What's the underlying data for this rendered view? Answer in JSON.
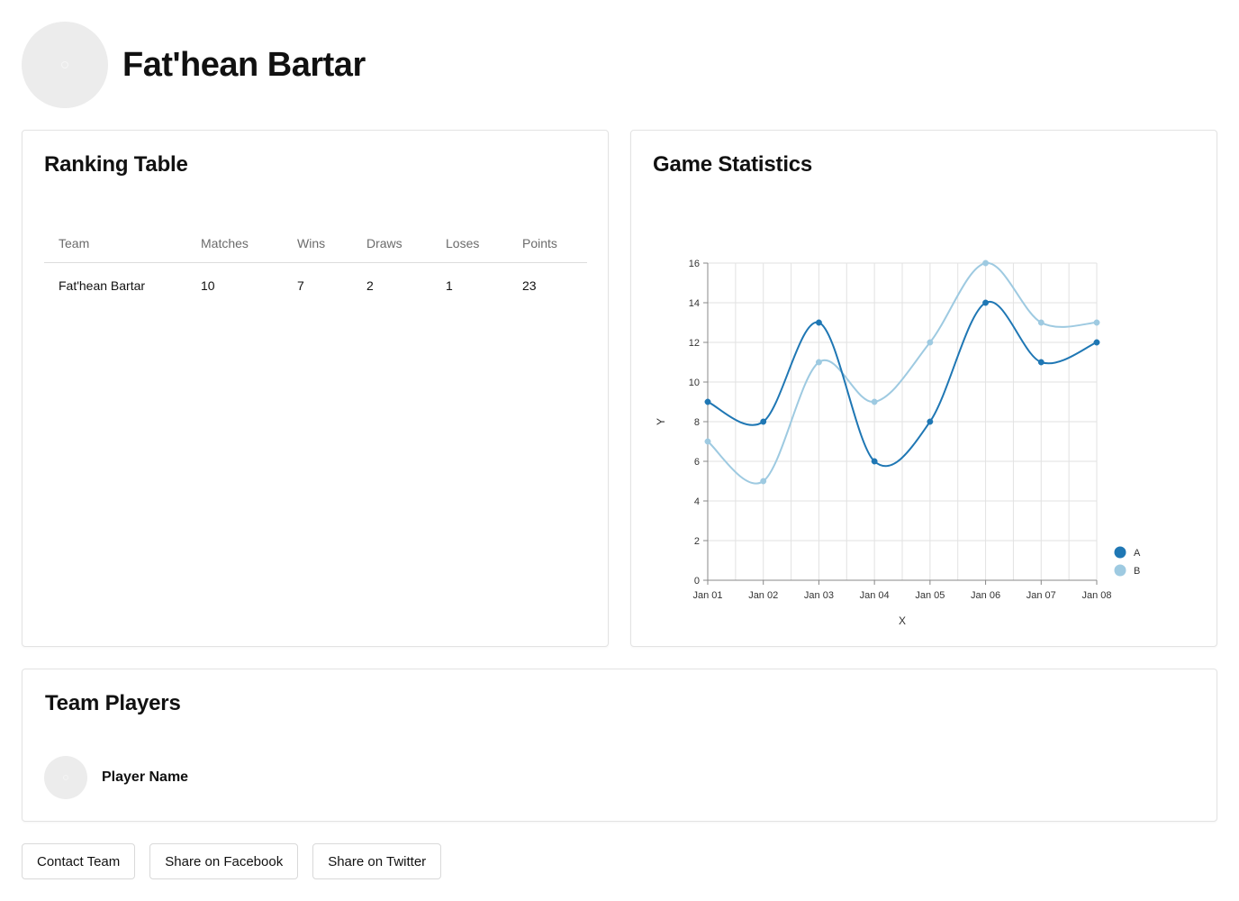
{
  "team": {
    "name": "Fat'hean Bartar"
  },
  "ranking": {
    "title": "Ranking Table",
    "columns": [
      "Team",
      "Matches",
      "Wins",
      "Draws",
      "Loses",
      "Points"
    ],
    "rows": [
      {
        "team": "Fat'hean Bartar",
        "matches": "10",
        "wins": "7",
        "draws": "2",
        "loses": "1",
        "points": "23"
      }
    ]
  },
  "stats": {
    "title": "Game Statistics"
  },
  "chart_data": {
    "type": "line",
    "title": "",
    "xlabel": "X",
    "ylabel": "Y",
    "categories": [
      "Jan 01",
      "Jan 02",
      "Jan 03",
      "Jan 04",
      "Jan 05",
      "Jan 06",
      "Jan 07",
      "Jan 08"
    ],
    "ylim": [
      0,
      16
    ],
    "yticks": [
      "0",
      "2",
      "4",
      "6",
      "8",
      "10",
      "12",
      "14",
      "16"
    ],
    "grid": true,
    "legend_position": "bottom-right",
    "series": [
      {
        "name": "A",
        "values": [
          9,
          8,
          13,
          6,
          8,
          14,
          11,
          12
        ],
        "color": "#1f77b4"
      },
      {
        "name": "B",
        "values": [
          7,
          5,
          11,
          9,
          12,
          16,
          13,
          13
        ],
        "color": "#9ecae1"
      }
    ]
  },
  "players": {
    "title": "Team Players",
    "items": [
      {
        "name": "Player Name"
      }
    ]
  },
  "actions": {
    "contact": "Contact Team",
    "facebook": "Share on Facebook",
    "twitter": "Share on Twitter"
  }
}
